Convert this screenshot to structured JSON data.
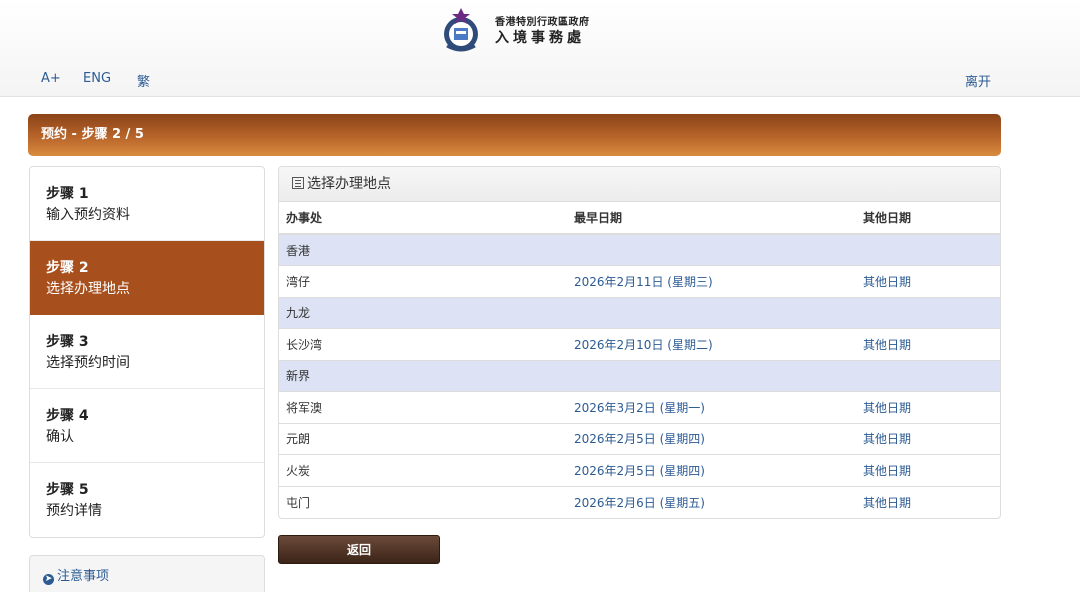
{
  "header": {
    "org_line1": "香港特別行政區政府",
    "org_line2": "入境事務處",
    "nav": {
      "font_size": "A+",
      "english": "ENG",
      "traditional": "繁",
      "exit": "离开"
    }
  },
  "banner": {
    "title": "预约 - 步骤 2 / 5"
  },
  "steps": [
    {
      "title": "步骤 1",
      "desc": "输入预约资料",
      "active": false
    },
    {
      "title": "步骤 2",
      "desc": "选择办理地点",
      "active": true
    },
    {
      "title": "步骤 3",
      "desc": "选择预约时间",
      "active": false
    },
    {
      "title": "步骤 4",
      "desc": "确认",
      "active": false
    },
    {
      "title": "步骤 5",
      "desc": "预约详情",
      "active": false
    }
  ],
  "notice": {
    "label": "注意事项"
  },
  "panel": {
    "title": "选择办理地点",
    "columns": [
      "办事处",
      "最早日期",
      "其他日期"
    ],
    "regions": [
      {
        "name": "香港",
        "offices": [
          {
            "office": "湾仔",
            "earliest": "2026年2月11日 (星期三)",
            "other": "其他日期"
          }
        ]
      },
      {
        "name": "九龙",
        "offices": [
          {
            "office": "长沙湾",
            "earliest": "2026年2月10日 (星期二)",
            "other": "其他日期"
          }
        ]
      },
      {
        "name": "新界",
        "offices": [
          {
            "office": "将军澳",
            "earliest": "2026年3月2日 (星期一)",
            "other": "其他日期"
          },
          {
            "office": "元朗",
            "earliest": "2026年2月5日 (星期四)",
            "other": "其他日期"
          },
          {
            "office": "火炭",
            "earliest": "2026年2月5日 (星期四)",
            "other": "其他日期"
          },
          {
            "office": "屯门",
            "earliest": "2026年2月6日 (星期五)",
            "other": "其他日期"
          }
        ]
      }
    ]
  },
  "actions": {
    "back": "返回"
  },
  "colors": {
    "accent": "#a8501d",
    "link": "#2c5b94",
    "region_row": "#dde3f5"
  }
}
